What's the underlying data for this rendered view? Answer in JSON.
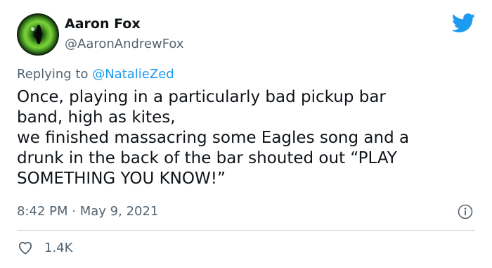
{
  "author": {
    "display_name": "Aaron Fox",
    "handle": "@AaronAndrewFox"
  },
  "reply": {
    "prefix": "Replying to ",
    "mention": "@NatalieZed"
  },
  "tweet": {
    "lines": [
      "Once, playing in a particularly bad pickup bar",
      "band, high as kites,",
      "we finished massacring some Eagles song and a",
      "drunk in the back of the bar shouted out “PLAY",
      "SOMETHING YOU KNOW!”"
    ]
  },
  "meta": {
    "time": "8:42 PM",
    "separator": "·",
    "date": "May 9, 2021"
  },
  "engagement": {
    "likes": "1.4K"
  },
  "icons": {
    "brand": "twitter-bird-icon",
    "info": "info-icon",
    "like": "heart-icon"
  },
  "colors": {
    "brand": "#1d9bf0",
    "text": "#0f1419",
    "secondary": "#536471",
    "divider": "#cfd9de"
  }
}
